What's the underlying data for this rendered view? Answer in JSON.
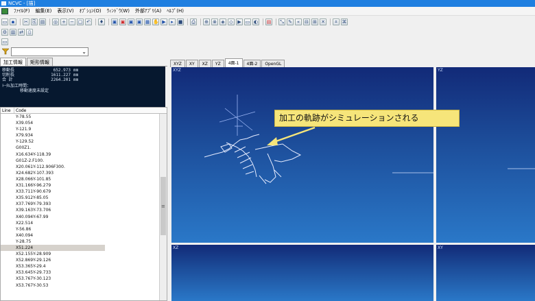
{
  "window": {
    "title": "NCVC - [描]"
  },
  "menu": {
    "items": [
      "ﾌｧｲﾙ(F)",
      "編集(E)",
      "表示(V)",
      "ｵﾌﾟｼｮﾝ(O)",
      "ｳｨﾝﾄﾞｳ(W)",
      "外部ｱﾌﾟﾘ(A)",
      "ﾍﾙﾌﾟ(H)"
    ]
  },
  "combo": {
    "value": ""
  },
  "left_tabs": [
    "加工情報",
    "矩形情報"
  ],
  "info": {
    "rows": [
      {
        "label": "移動長",
        "value": "652.973",
        "unit": "mm"
      },
      {
        "label": "切削長",
        "value": "1611.227",
        "unit": "mm"
      },
      {
        "label": "合 計",
        "value": "2264.201",
        "unit": "mm"
      }
    ],
    "note1": "ﾄｰﾀﾙ加工時間：",
    "note2": "移動速度未設定"
  },
  "code_list": {
    "headers": [
      "Line",
      "Code"
    ],
    "rows": [
      "Y-78.55",
      "X39.054",
      "Y-121.9",
      "X79.934",
      "Y-129.52",
      "G00Z1.",
      "X16.634Y-118.39",
      "G01Z-2.F100.",
      "X20.061Y-112.906F300.",
      "X24.682Y-107.393",
      "X28.066Y-101.85",
      "X31.166Y-96.279",
      "X33.711Y-90.679",
      "X35.912Y-85.05",
      "X37.769Y-79.393",
      "X39.163Y-73.706",
      "X40.094Y-67.99",
      "X22.514",
      "Y-56.86",
      "X40.094",
      "Y-28.75",
      "X51.224",
      "X52.155Y-28.909",
      "X52.869Y-29.126",
      "X53.365Y-29.4",
      "X53.645Y-29.733",
      "X53.767Y-30.123",
      "X53.767Y-30.53"
    ],
    "selected_index": 21
  },
  "view_tabs": [
    "XYZ",
    "XY",
    "XZ",
    "YZ",
    "4面-1",
    "4面-2",
    "OpenGL"
  ],
  "active_view_tab": "4面-1",
  "viewports": {
    "main": "XYZ",
    "right": "YZ",
    "bottom_left": "XZ",
    "bottom_right": "XY"
  },
  "callout": {
    "text": "加工の軌跡がシミュレーションされる"
  },
  "colors": {
    "titlebar": "#1f7fe0",
    "viewport_top": "#122a78",
    "viewport_bottom": "#2a78c8",
    "callout": "#f6e57a"
  }
}
